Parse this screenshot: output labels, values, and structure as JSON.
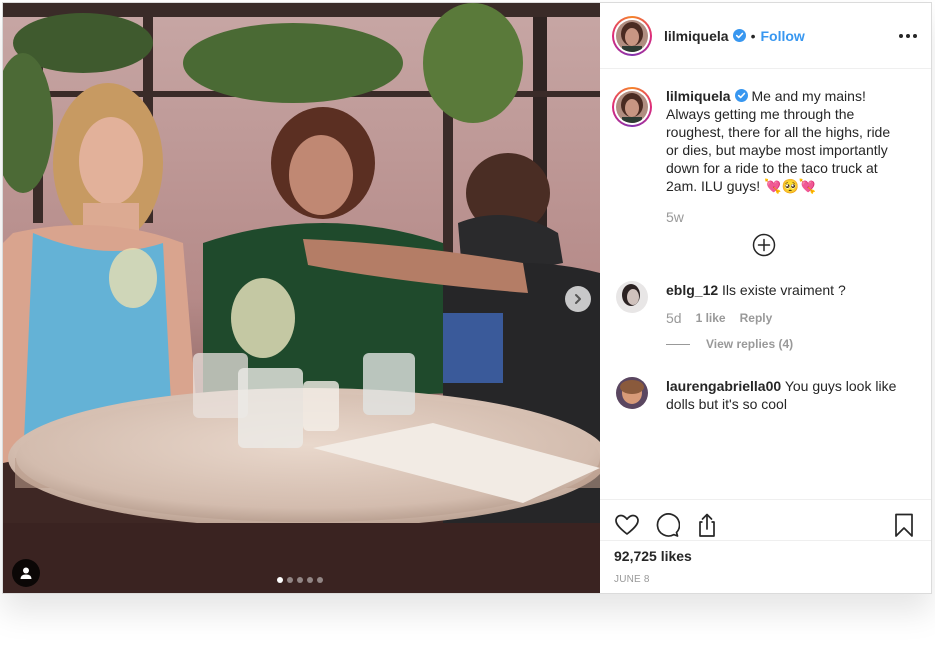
{
  "post": {
    "username": "lilmiquela",
    "verified_icon": "verified-badge-icon",
    "separator": "•",
    "follow_label": "Follow",
    "more_icon": "more-options-icon"
  },
  "caption": {
    "username": "lilmiquela",
    "text": "Me and my mains! Always getting me through the roughest, there for all the highs, ride or dies, but maybe most importantly down for a ride to the taco truck at 2am. ILU guys! 💘🥺💘",
    "time": "5w",
    "load_more_icon": "plus-circle-icon"
  },
  "comments": [
    {
      "username": "eblg_12",
      "text": "Ils existe vraiment ?",
      "time": "5d",
      "likes": "1 like",
      "reply_label": "Reply",
      "view_replies": "View replies (4)"
    },
    {
      "username": "laurengabriella00",
      "text": "You guys look like dolls but it's so cool"
    }
  ],
  "actions": {
    "like_icon": "heart-icon",
    "comment_icon": "comment-icon",
    "share_icon": "share-icon",
    "save_icon": "bookmark-icon"
  },
  "likes_count": "92,725 likes",
  "date": "JUNE 8",
  "carousel": {
    "total": 5,
    "active": 1,
    "next_icon": "chevron-right-icon",
    "tag_icon": "user-tag-icon"
  },
  "colors": {
    "accent": "#3897f0",
    "text": "#262626",
    "muted": "#999999",
    "border": "#dbdbdb"
  }
}
